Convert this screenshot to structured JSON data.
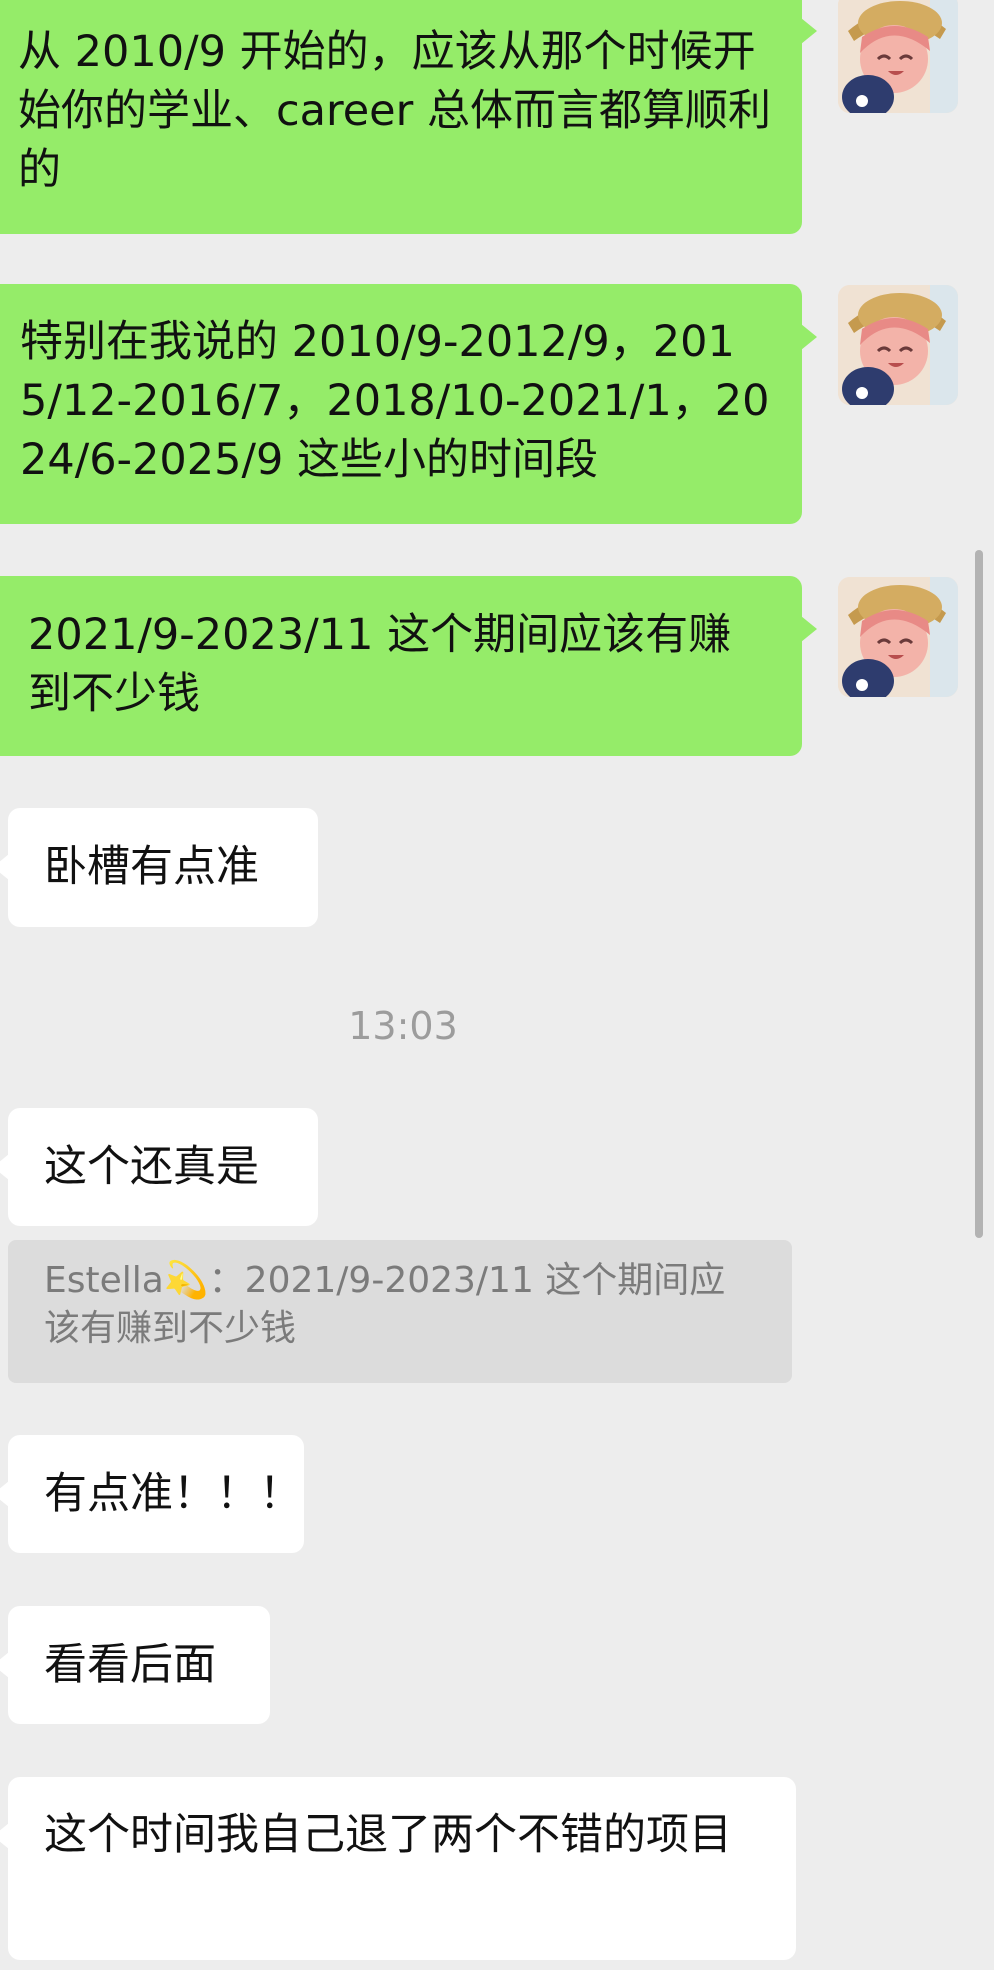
{
  "messages": [
    {
      "id": "m1",
      "side": "sent",
      "text": "从 2010/9 开始的，应该从那个时候开始你的学业、career 总体而言都算顺利的"
    },
    {
      "id": "m2",
      "side": "sent",
      "text": "特别在我说的 2010/9-2012/9，2015/12-2016/7，2018/10-2021/1，2024/6-2025/9 这些小的时间段"
    },
    {
      "id": "m3",
      "side": "sent",
      "text": "2021/9-2023/11 这个期间应该有赚到不少钱"
    },
    {
      "id": "m4",
      "side": "received",
      "text": "卧槽有点准"
    },
    {
      "id": "m5",
      "side": "received",
      "text": "这个还真是"
    },
    {
      "id": "m6",
      "side": "received",
      "text": "有点准！！！"
    },
    {
      "id": "m7",
      "side": "received",
      "text": "看看后面"
    },
    {
      "id": "m8",
      "side": "received",
      "text": "这个时间我自己退了两个不错的项目"
    }
  ],
  "timestamp": "13:03",
  "quote": {
    "sender": "Estella💫",
    "separator": "：",
    "text": "2021/9-2023/11 这个期间应该有赚到不少钱"
  },
  "avatar": {
    "icon": "anime-girl-avatar-icon"
  },
  "colors": {
    "background": "#ededed",
    "sent_bubble": "#95ec69",
    "received_bubble": "#ffffff",
    "quote_background": "#dcdcdc"
  }
}
